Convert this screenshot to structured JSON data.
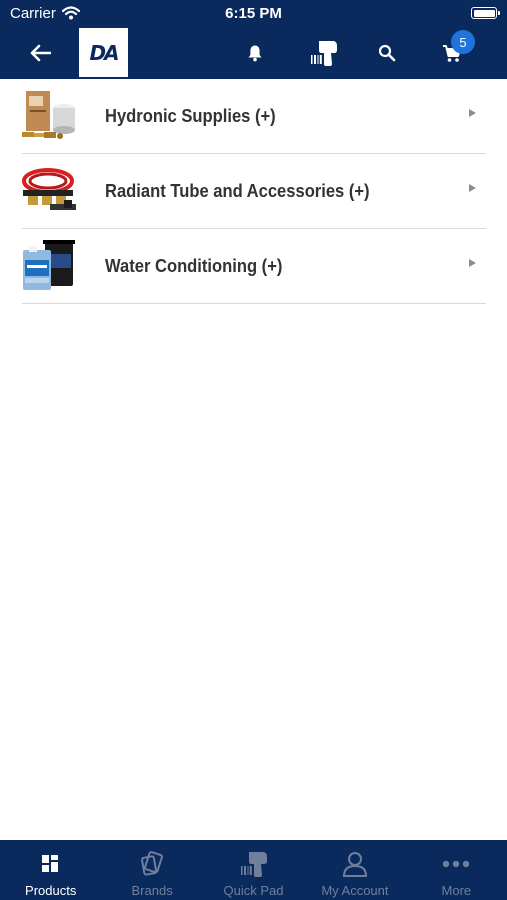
{
  "status": {
    "carrier": "Carrier",
    "time": "6:15 PM"
  },
  "header": {
    "logo_text": "DA",
    "cart_count": "5"
  },
  "categories": [
    {
      "label": "Hydronic Supplies (+)",
      "icon": "hydronic-supplies-image"
    },
    {
      "label": "Radiant Tube and Accessories (+)",
      "icon": "radiant-tube-image"
    },
    {
      "label": "Water Conditioning (+)",
      "icon": "water-conditioning-image"
    }
  ],
  "tabs": [
    {
      "label": "Products",
      "icon": "grid-icon",
      "active": true
    },
    {
      "label": "Brands",
      "icon": "tags-icon",
      "active": false
    },
    {
      "label": "Quick Pad",
      "icon": "scanner-icon",
      "active": false
    },
    {
      "label": "My Account",
      "icon": "person-icon",
      "active": false
    },
    {
      "label": "More",
      "icon": "ellipsis-icon",
      "active": false
    }
  ],
  "colors": {
    "primary": "#0a2a5e",
    "badge": "#1e74d8",
    "inactive_tab": "#6f7f9c",
    "text": "#333333"
  }
}
